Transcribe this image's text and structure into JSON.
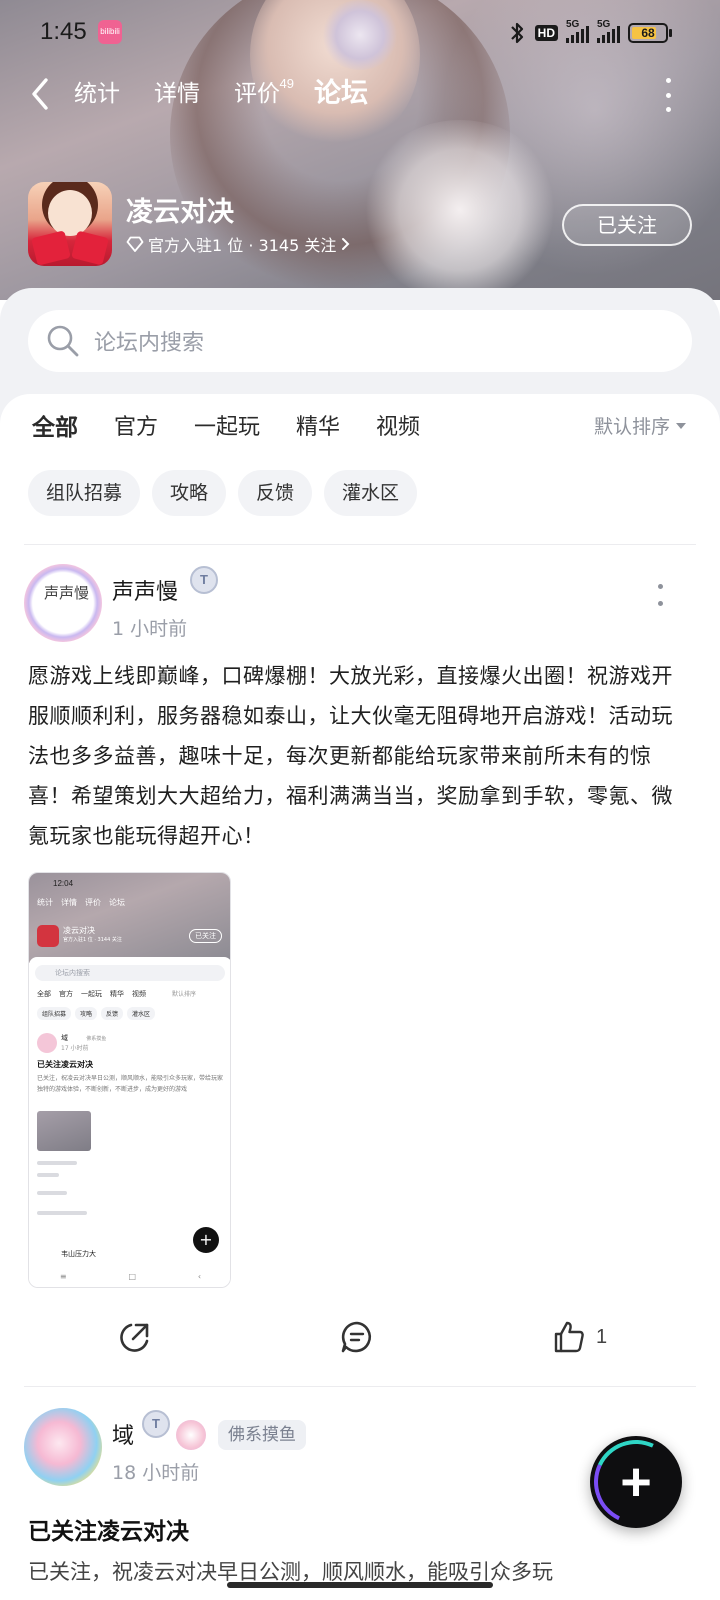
{
  "status_bar": {
    "time": "1:45",
    "app_notif": "bilibili",
    "hd": "HD",
    "sim1": "5G",
    "sim2": "5G",
    "battery": "68"
  },
  "nav": {
    "tabs": [
      {
        "label": "统计"
      },
      {
        "label": "详情"
      },
      {
        "label": "评价",
        "badge": "49"
      },
      {
        "label": "论坛"
      }
    ],
    "active_tab": "论坛"
  },
  "game": {
    "title": "凌云对决",
    "meta": "官方入驻1 位 · 3145 关注",
    "follow_label": "已关注"
  },
  "search": {
    "placeholder": "论坛内搜索"
  },
  "filter_tabs": [
    "全部",
    "官方",
    "一起玩",
    "精华",
    "视频"
  ],
  "sort_label": "默认排序",
  "chips": [
    "组队招募",
    "攻略",
    "反馈",
    "灌水区"
  ],
  "posts": [
    {
      "author": "声声慢",
      "avatar_text": "声声慢",
      "time": "1 小时前",
      "body": "愿游戏上线即巅峰，口碑爆棚！大放光彩，直接爆火出圈！祝游戏开服顺顺利利，服务器稳如泰山，让大伙毫无阻碍地开启游戏！活动玩法也多多益善，趣味十足，每次更新都能给玩家带来前所未有的惊喜！希望策划大大超给力，福利满满当当，奖励拿到手软，零氪、微氪玩家也能玩得超开心！",
      "like_count": "1"
    },
    {
      "author": "域",
      "tag": "佛系摸鱼",
      "time": "18 小时前",
      "title": "已关注凌云对决",
      "body_preview": "已关注，祝凌云对决早日公测，顺风顺水，能吸引众多玩"
    }
  ],
  "thumbnail": {
    "time": "12:04",
    "tabs": [
      "统计",
      "详情",
      "评价",
      "论坛"
    ],
    "title": "凌云对决",
    "meta": "官方入驻1 位 · 3144 关注",
    "follow": "已关注",
    "search": "论坛内搜索",
    "ftabs": [
      "全部",
      "官方",
      "一起玩",
      "精华",
      "视频",
      "默认排序"
    ],
    "chips": [
      "组队招募",
      "攻略",
      "反馈",
      "灌水区"
    ],
    "post_name": "域",
    "post_tag": "佛系摸鱼",
    "post_time": "17 小时前",
    "post_title": "已关注凌云对决",
    "post_body": "已关注，祝凌云对决早日公测，顺风顺水，能吸引众多玩家，带给玩家独特的游戏体验，不断创新，不断进步，成为更好的游戏",
    "next_name": "韦山压力大"
  },
  "colors": {
    "accent": "#29d3c1",
    "header_bg": "#9a939b",
    "panel_bg": "#f1f2f5"
  }
}
